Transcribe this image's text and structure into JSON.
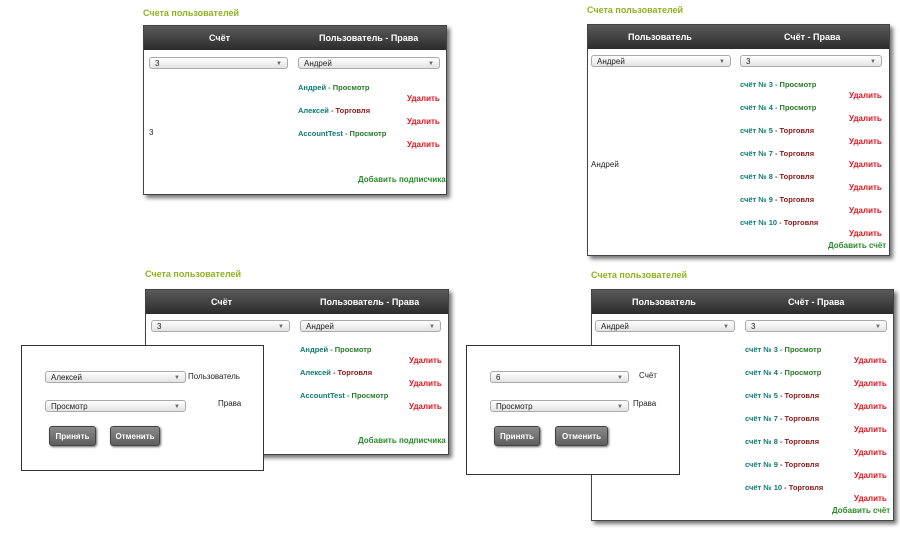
{
  "q1": {
    "title": "Счета пользователей",
    "header": {
      "col1": "Счёт",
      "col2": "Пользователь - Права"
    },
    "account_select": "3",
    "user_select": "Андрей",
    "row_account": "3",
    "permissions": [
      {
        "name": "Андрей",
        "sep": " - ",
        "right": "Просмотр",
        "kind": "v"
      },
      {
        "name": "Алексей",
        "sep": " - ",
        "right": "Торговля",
        "kind": "t"
      },
      {
        "name": "AccountTest",
        "sep": " - ",
        "right": "Просмотр",
        "kind": "v"
      }
    ],
    "delete_label": "Удалить",
    "add_label": "Добавить подписчика"
  },
  "q2": {
    "title": "Счета пользователей",
    "header": {
      "col1": "Пользователь",
      "col2": "Счёт - Права"
    },
    "user_select": "Андрей",
    "account_select": "3",
    "row_user": "Андрей",
    "accounts": [
      {
        "name": "счёт № 3",
        "sep": " - ",
        "right": "Просмотр",
        "kind": "v"
      },
      {
        "name": "счёт № 4",
        "sep": " - ",
        "right": "Просмотр",
        "kind": "v"
      },
      {
        "name": "счёт № 5",
        "sep": " - ",
        "right": "Торговля",
        "kind": "t"
      },
      {
        "name": "счёт № 7",
        "sep": " - ",
        "right": "Торговля",
        "kind": "t"
      },
      {
        "name": "счёт № 8",
        "sep": " - ",
        "right": "Торговля",
        "kind": "t"
      },
      {
        "name": "счёт № 9",
        "sep": " - ",
        "right": "Торговля",
        "kind": "t"
      },
      {
        "name": "счёт № 10",
        "sep": " - ",
        "right": "Торговля",
        "kind": "t"
      }
    ],
    "delete_label": "Удалить",
    "add_label": "Добавить счёт"
  },
  "q3": {
    "title": "Счета пользователей",
    "header": {
      "col1": "Счёт",
      "col2": "Пользователь - Права"
    },
    "account_select": "3",
    "user_select": "Андрей",
    "permissions": [
      {
        "name": "Андрей",
        "sep": " - ",
        "right": "Просмотр",
        "kind": "v"
      },
      {
        "name": "Алексей",
        "sep": " - ",
        "right": "Торговля",
        "kind": "t"
      },
      {
        "name": "AccountTest",
        "sep": " - ",
        "right": "Просмотр",
        "kind": "v"
      }
    ],
    "delete_label": "Удалить",
    "add_label": "Добавить подписчика",
    "dialog": {
      "user_value": "Алексей",
      "user_label": "Пользователь",
      "right_value": "Просмотр",
      "right_label": "Права",
      "accept": "Принять",
      "cancel": "Отменить"
    }
  },
  "q4": {
    "title": "Счета пользователей",
    "header": {
      "col1": "Пользователь",
      "col2": "Счёт - Права"
    },
    "user_select": "Андрей",
    "account_select": "3",
    "accounts": [
      {
        "name": "счёт № 3",
        "sep": " - ",
        "right": "Просмотр",
        "kind": "v"
      },
      {
        "name": "счёт № 4",
        "sep": " - ",
        "right": "Просмотр",
        "kind": "v"
      },
      {
        "name": "счёт № 5",
        "sep": " - ",
        "right": "Торговля",
        "kind": "t"
      },
      {
        "name": "счёт № 7",
        "sep": " - ",
        "right": "Торговля",
        "kind": "t"
      },
      {
        "name": "счёт № 8",
        "sep": " - ",
        "right": "Торговля",
        "kind": "t"
      },
      {
        "name": "счёт № 9",
        "sep": " - ",
        "right": "Торговля",
        "kind": "t"
      },
      {
        "name": "счёт № 10",
        "sep": " - ",
        "right": "Торговля",
        "kind": "t"
      }
    ],
    "delete_label": "Удалить",
    "add_label": "Добавить счёт",
    "dialog": {
      "account_value": "6",
      "account_label": "Счёт",
      "right_value": "Просмотр",
      "right_label": "Права",
      "accept": "Принять",
      "cancel": "Отменить"
    }
  }
}
